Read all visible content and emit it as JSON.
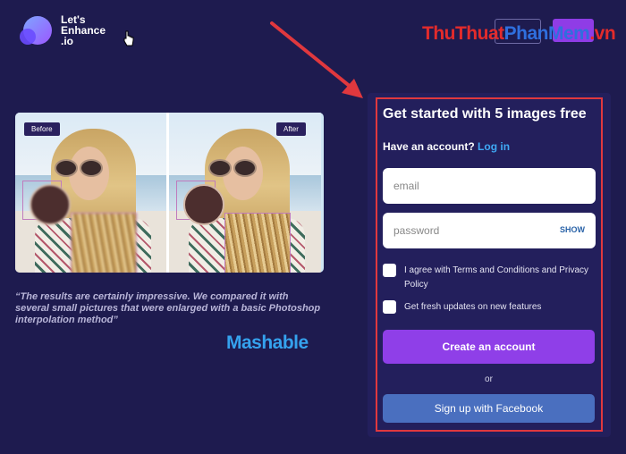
{
  "header": {
    "logo_line1": "Let's",
    "logo_line2": "Enhance",
    "logo_line3": ".io",
    "watermark": {
      "part1": "ThuThuat",
      "part2": "PhanMem",
      "part3": ".vn"
    }
  },
  "comparison": {
    "before_label": "Before",
    "after_label": "After"
  },
  "testimonial": {
    "quote": "“The results are certainly impressive. We compared it with several small pictures that were enlarged with a basic Photoshop interpolation method”",
    "source": "Mashable"
  },
  "signup": {
    "title": "Get started with 5 images free",
    "have_account": "Have an account?",
    "login_link": "Log in",
    "email_placeholder": "email",
    "password_placeholder": "password",
    "show_label": "SHOW",
    "terms_label": "I agree with Terms and Conditions and Privacy Policy",
    "updates_label": "Get fresh updates on new features",
    "create_button": "Create an account",
    "or_label": "or",
    "facebook_button": "Sign up with Facebook"
  },
  "colors": {
    "background": "#1e1b4f",
    "panel": "#231f5c",
    "accent_purple": "#8f3fe8",
    "facebook_blue": "#4a6fbf",
    "link_blue": "#3fa9f5",
    "highlight_red": "#e0383e"
  }
}
